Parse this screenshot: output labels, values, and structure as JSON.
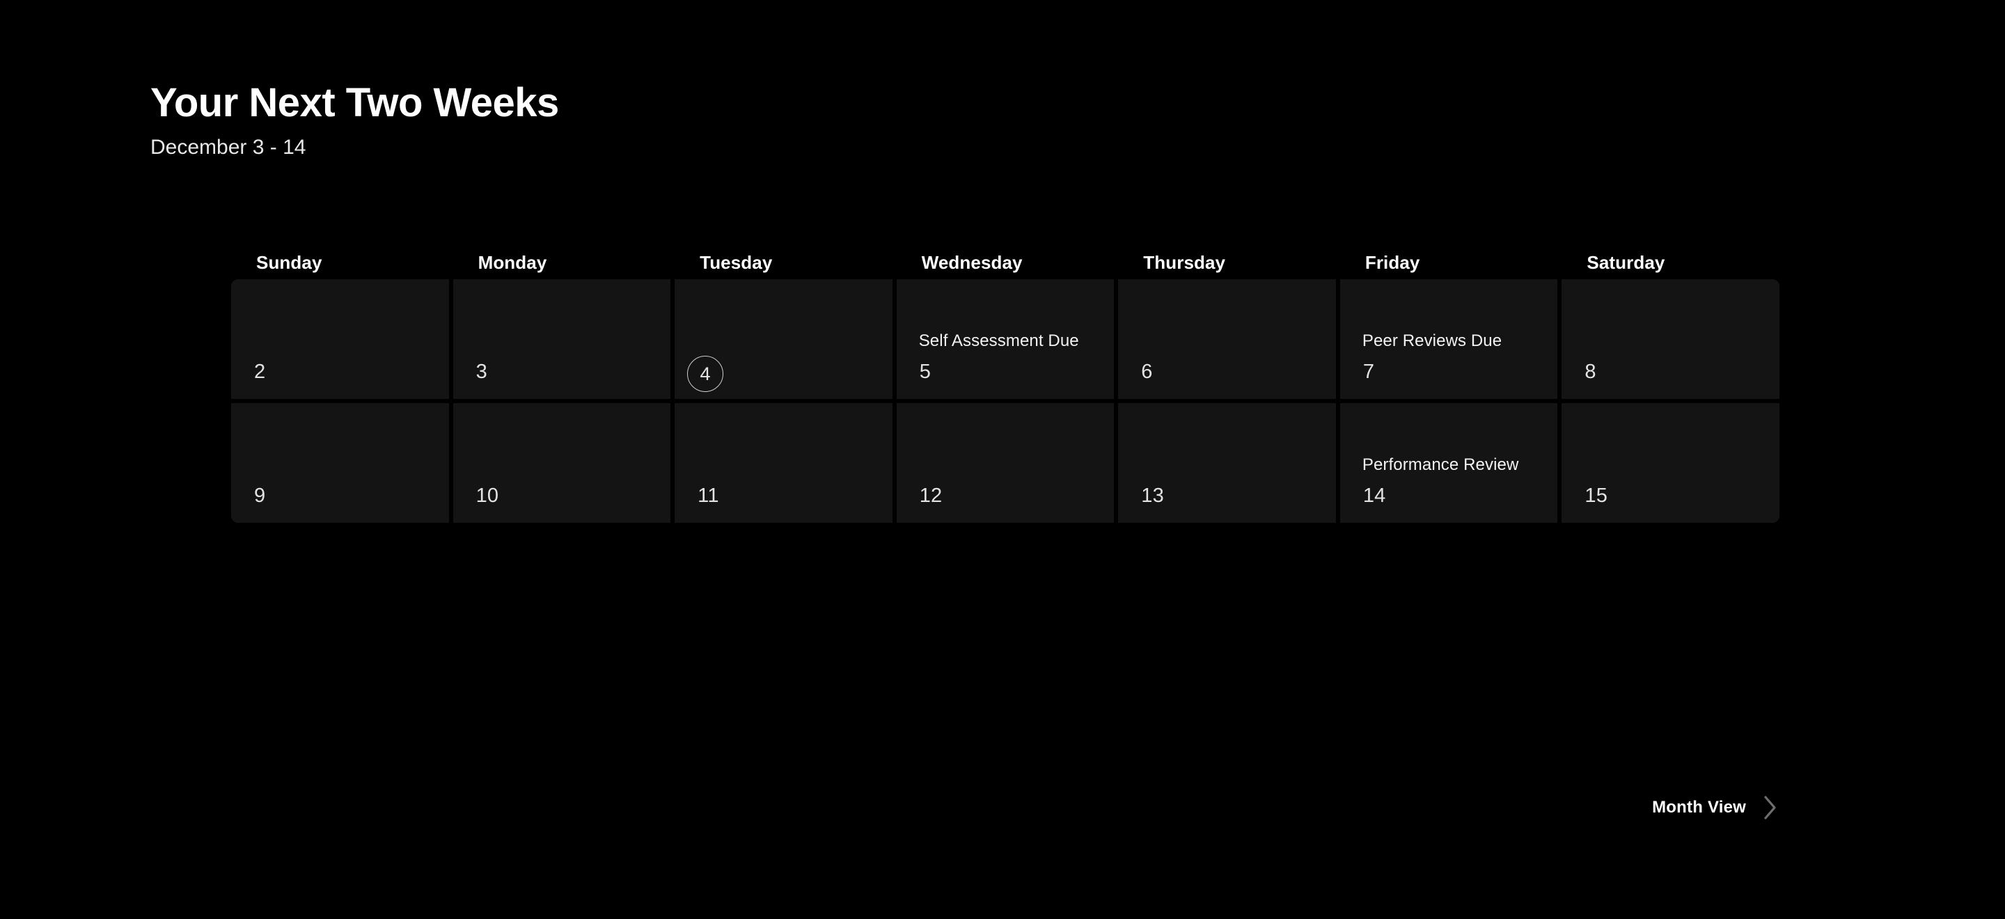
{
  "header": {
    "title": "Your Next Two Weeks",
    "subtitle": "December 3 - 14"
  },
  "calendar": {
    "weekdays": [
      {
        "label": "Sunday"
      },
      {
        "label": "Monday"
      },
      {
        "label": "Tuesday"
      },
      {
        "label": "Wednesday"
      },
      {
        "label": "Thursday"
      },
      {
        "label": "Friday"
      },
      {
        "label": "Saturday"
      }
    ],
    "days": [
      {
        "number": "2",
        "event": "",
        "today": false
      },
      {
        "number": "3",
        "event": "",
        "today": false
      },
      {
        "number": "4",
        "event": "",
        "today": true
      },
      {
        "number": "5",
        "event": "Self Assessment Due",
        "today": false
      },
      {
        "number": "6",
        "event": "",
        "today": false
      },
      {
        "number": "7",
        "event": "Peer Reviews Due",
        "today": false
      },
      {
        "number": "8",
        "event": "",
        "today": false
      },
      {
        "number": "9",
        "event": "",
        "today": false
      },
      {
        "number": "10",
        "event": "",
        "today": false
      },
      {
        "number": "11",
        "event": "",
        "today": false
      },
      {
        "number": "12",
        "event": "",
        "today": false
      },
      {
        "number": "13",
        "event": "",
        "today": false
      },
      {
        "number": "14",
        "event": "Performance Review",
        "today": false
      },
      {
        "number": "15",
        "event": "",
        "today": false
      }
    ]
  },
  "footer": {
    "month_view_label": "Month View",
    "chevron_icon": "chevron-right-icon"
  },
  "colors": {
    "background": "#000000",
    "cell": "#141414",
    "text_primary": "#ffffff",
    "text_secondary": "#e3e3e3",
    "today_ring": "#cfcfcf",
    "chevron": "#6e6e6e"
  }
}
